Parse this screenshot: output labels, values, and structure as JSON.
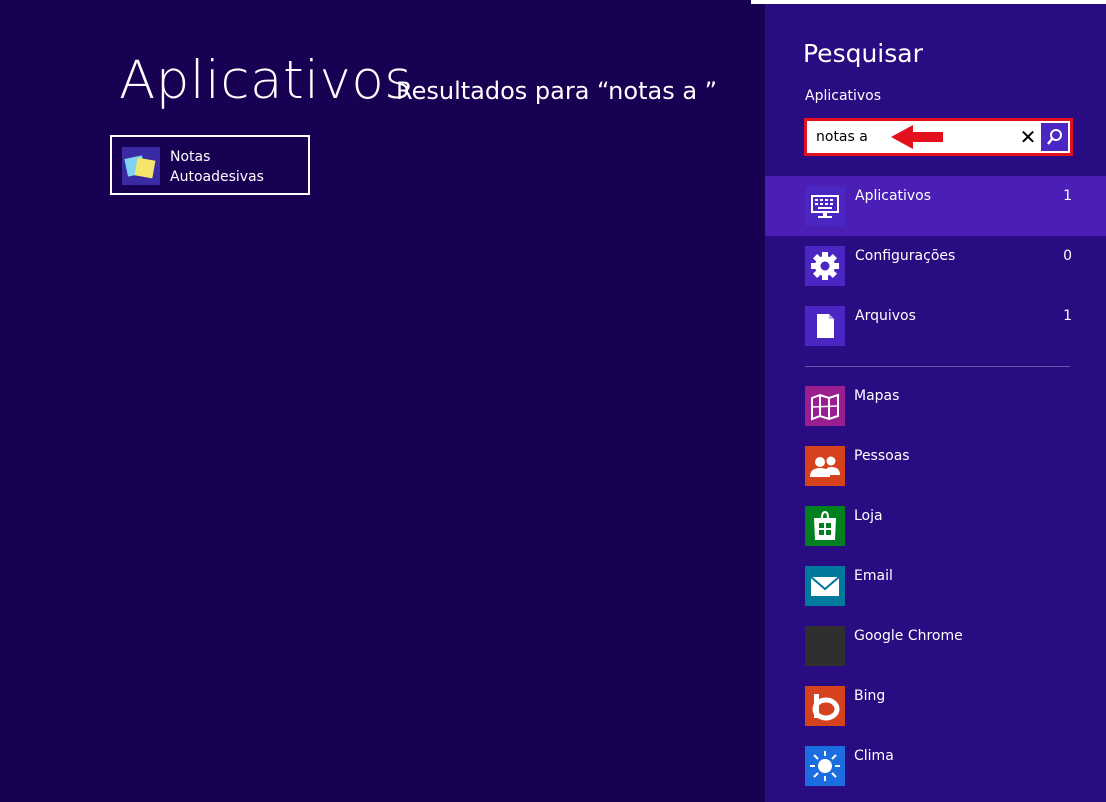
{
  "main": {
    "title": "Aplicativos",
    "subtitle": "Resultados para “notas a ”",
    "results": [
      {
        "line1": "Notas",
        "line2": "Autoadesivas",
        "icon": "sticky-notes-icon"
      }
    ]
  },
  "search_pane": {
    "title": "Pesquisar",
    "scope_label": "Aplicativos",
    "query": "notas a",
    "categories": [
      {
        "label": "Aplicativos",
        "count": "1",
        "icon": "keyboard-monitor-icon"
      },
      {
        "label": "Configurações",
        "count": "0",
        "icon": "gear-icon"
      },
      {
        "label": "Arquivos",
        "count": "1",
        "icon": "file-icon"
      }
    ],
    "apps": [
      {
        "label": "Mapas",
        "icon": "map-icon",
        "color": "#9b1e91"
      },
      {
        "label": "Pessoas",
        "icon": "people-icon",
        "color": "#d6421d"
      },
      {
        "label": "Loja",
        "icon": "store-icon",
        "color": "#00801f"
      },
      {
        "label": "Email",
        "icon": "mail-icon",
        "color": "#00799c"
      },
      {
        "label": "Google Chrome",
        "icon": "chrome-icon",
        "color": "#2f2f2f"
      },
      {
        "label": "Bing",
        "icon": "bing-icon",
        "color": "#d6421d"
      },
      {
        "label": "Clima",
        "icon": "weather-icon",
        "color": "#1c6ee0"
      }
    ],
    "colors": {
      "pane_bg": "#2a0c82",
      "selected_bg": "#4b1eb6",
      "highlight": "#e3101d"
    }
  }
}
